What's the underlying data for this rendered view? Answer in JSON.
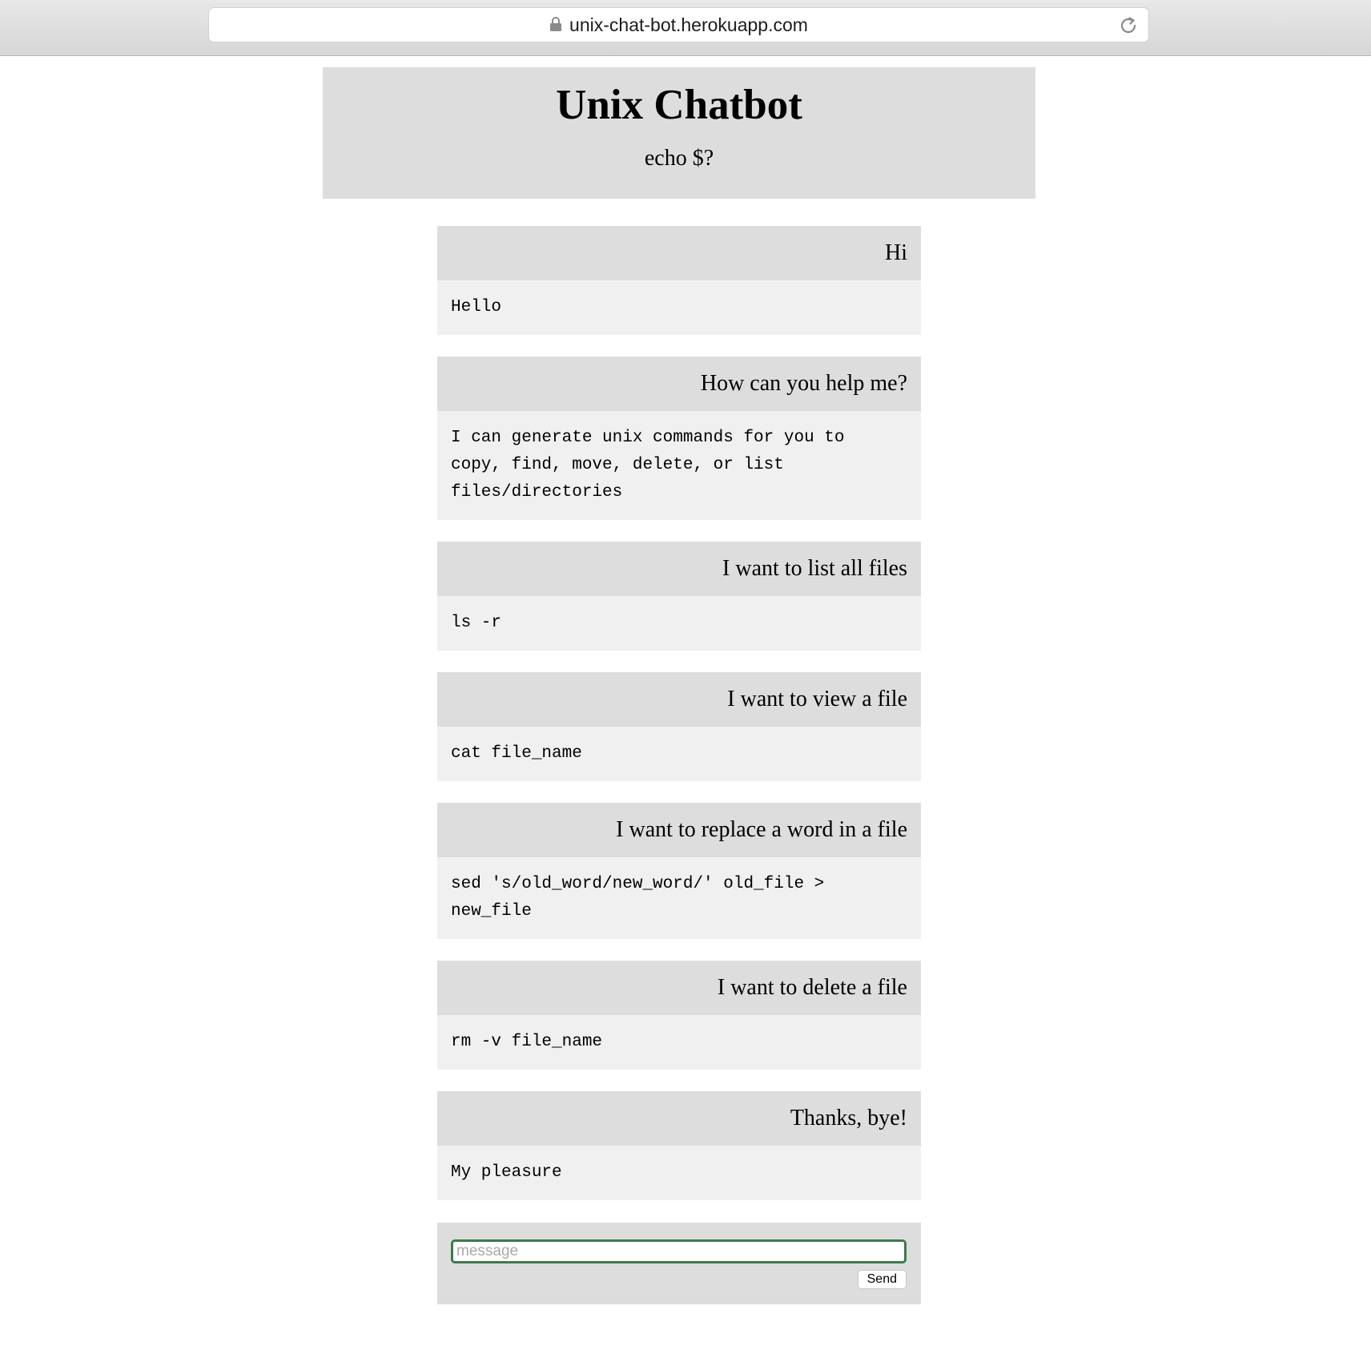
{
  "browser": {
    "url": "unix-chat-bot.herokuapp.com",
    "lock_icon": "lock-icon",
    "reload_icon": "reload-icon"
  },
  "header": {
    "title": "Unix Chatbot",
    "subtitle": "echo $?"
  },
  "conversation": [
    {
      "user": "Hi",
      "bot": "Hello"
    },
    {
      "user": "How can you help me?",
      "bot": "I can generate unix commands for you to\ncopy, find, move, delete, or list\nfiles/directories"
    },
    {
      "user": "I want to list all files",
      "bot": "ls -r"
    },
    {
      "user": "I want to view a file",
      "bot": "cat file_name"
    },
    {
      "user": "I want to replace a word in a file",
      "bot": "sed 's/old_word/new_word/' old_file >\nnew_file"
    },
    {
      "user": "I want to delete a file",
      "bot": "rm -v file_name"
    },
    {
      "user": "Thanks, bye!",
      "bot": "My pleasure"
    }
  ],
  "input": {
    "placeholder": "message",
    "value": "",
    "send_label": "Send"
  },
  "colors": {
    "header_bg": "#dddddd",
    "user_bubble_bg": "#dddddd",
    "bot_bubble_bg": "#f0f0f0",
    "input_focus_border": "#3d7a4d"
  }
}
